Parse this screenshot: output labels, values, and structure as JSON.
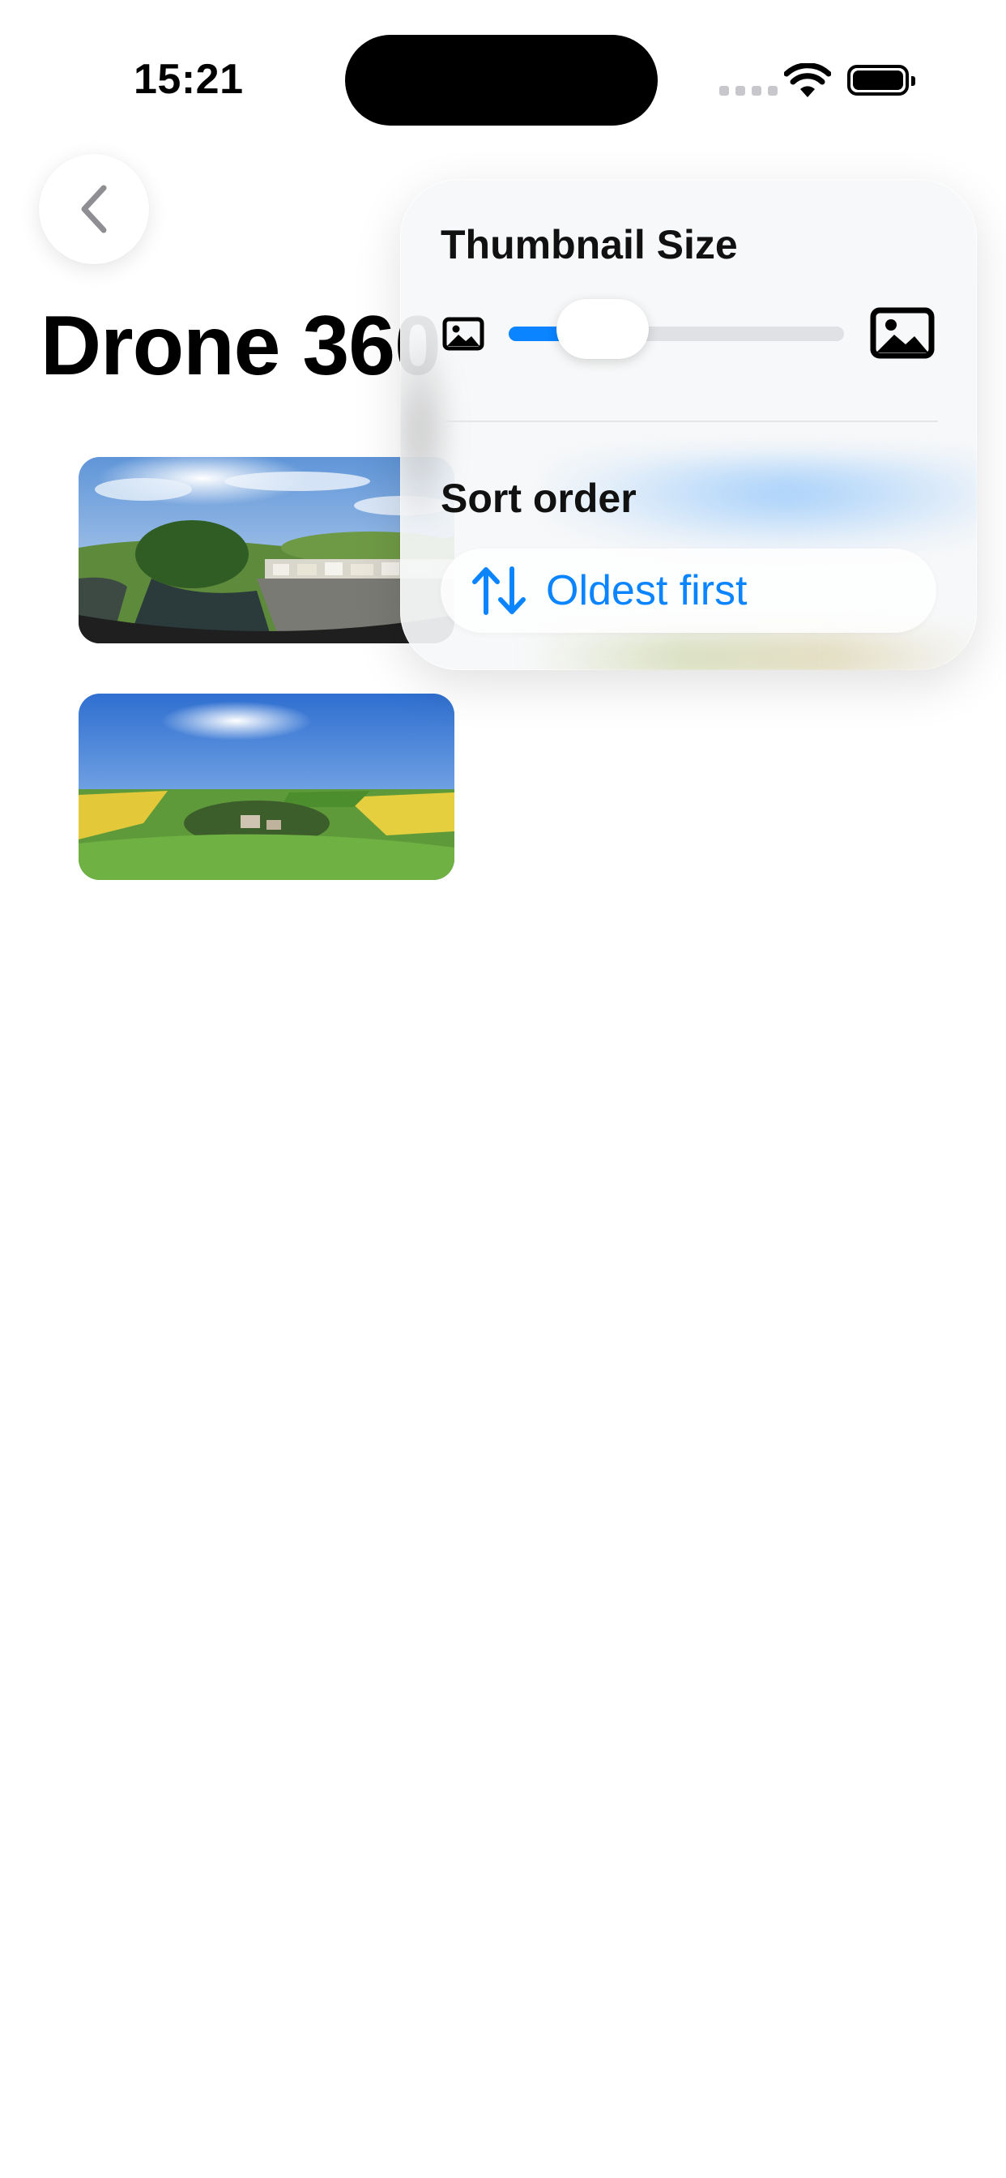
{
  "status_bar": {
    "time": "15:21"
  },
  "navigation": {
    "back_icon": "chevron-left-icon"
  },
  "page": {
    "title": "Drone 360"
  },
  "thumbnails": [
    {
      "name": "river-town-panorama"
    },
    {
      "name": "village-fields-panorama"
    }
  ],
  "menu": {
    "thumbnail_size": {
      "label": "Thumbnail Size",
      "small_icon": "photo-small-icon",
      "large_icon": "photo-large-icon",
      "slider_value_percent": 28
    },
    "sort_order": {
      "label": "Sort order",
      "option_icon": "arrow-up-down-icon",
      "option_label": "Oldest first"
    }
  },
  "colors": {
    "accent": "#0a84ff",
    "track": "#dfe1e4",
    "panel": "#f6f7f8"
  }
}
